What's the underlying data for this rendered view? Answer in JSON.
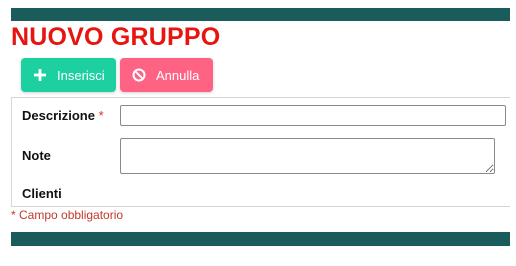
{
  "page": {
    "title": "NUOVO GRUPPO"
  },
  "toolbar": {
    "insert_label": "Inserisci",
    "cancel_label": "Annulla",
    "insert_icon": "plus-icon",
    "cancel_icon": "ban-icon",
    "insert_color": "#1dd0a0",
    "cancel_color": "#ff6384"
  },
  "form": {
    "description_label": "Descrizione",
    "description_required_mark": "*",
    "description_value": "",
    "note_label": "Note",
    "note_value": "",
    "clients_label": "Clienti"
  },
  "footer": {
    "required_note": "* Campo obbligatorio"
  },
  "colors": {
    "header_bar": "#1a5c5c",
    "title": "#e8140f"
  }
}
